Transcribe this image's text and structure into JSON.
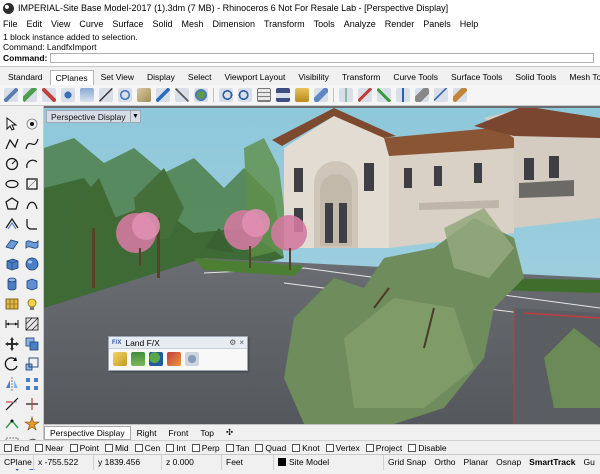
{
  "window": {
    "title": "IMPERIAL-Site Base Model-2017 (1).3dm (7 MB) - Rhinoceros 6 Not For Resale Lab - [Perspective Display]"
  },
  "menu": [
    "File",
    "Edit",
    "View",
    "Curve",
    "Surface",
    "Solid",
    "Mesh",
    "Dimension",
    "Transform",
    "Tools",
    "Analyze",
    "Render",
    "Panels",
    "Help"
  ],
  "command": {
    "history": [
      "1 block instance added to selection.",
      "Command: LandfxImport"
    ],
    "prompt": "Command:"
  },
  "toolbar_tabs": [
    "Standard",
    "CPlanes",
    "Set View",
    "Display",
    "Select",
    "Viewport Layout",
    "Visibility",
    "Transform",
    "Curve Tools",
    "Surface Tools",
    "Solid Tools",
    "Mesh Too"
  ],
  "active_toolbar_tab": "CPlanes",
  "viewport": {
    "label": "Perspective Display",
    "dropdown_glyph": "▼"
  },
  "landfx": {
    "title": "Land F/X",
    "logo": "F/X",
    "gear": "⚙",
    "close": "×"
  },
  "viewport_tabs": [
    "Perspective Display",
    "Right",
    "Front",
    "Top"
  ],
  "add_tab_glyph": "✣",
  "osnaps": [
    "End",
    "Near",
    "Point",
    "Mid",
    "Cen",
    "Int",
    "Perp",
    "Tan",
    "Quad",
    "Knot",
    "Vertex",
    "Project",
    "Disable"
  ],
  "status": {
    "cplane": "CPlane",
    "x": "x -755.522",
    "y": "y 1839.456",
    "z": "z 0.000",
    "units": "Feet",
    "layer": "Site Model",
    "toggles": [
      "Grid Snap",
      "Ortho",
      "Planar",
      "Osnap",
      "SmartTrack",
      "Gu"
    ]
  },
  "colors": {
    "sky": "#8fc4d6",
    "roof": "#7d4a2f",
    "stucco": "#e3dcd3",
    "asphalt": "#5f6368",
    "grass": "#3f6e2c"
  }
}
